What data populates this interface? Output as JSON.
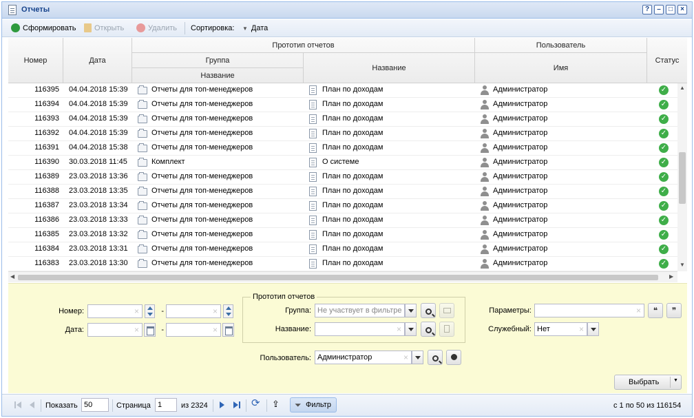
{
  "window": {
    "title": "Отчеты",
    "buttons": [
      "?",
      "–",
      "□",
      "×"
    ]
  },
  "toolbar": {
    "generate": "Сформировать",
    "open": "Открыть",
    "delete": "Удалить",
    "sort_label": "Сортировка:",
    "sort_value": "Дата"
  },
  "grid": {
    "headers": {
      "number": "Номер",
      "date": "Дата",
      "prototype": "Прототип отчетов",
      "group": "Группа",
      "group_name": "Название",
      "name": "Название",
      "user": "Пользователь",
      "user_name": "Имя",
      "status": "Статус"
    },
    "rows": [
      {
        "num": "116395",
        "date": "04.04.2018 15:39",
        "group": "Отчеты для топ-менеджеров",
        "name": "План по доходам",
        "user": "Администратор"
      },
      {
        "num": "116394",
        "date": "04.04.2018 15:39",
        "group": "Отчеты для топ-менеджеров",
        "name": "План по доходам",
        "user": "Администратор"
      },
      {
        "num": "116393",
        "date": "04.04.2018 15:39",
        "group": "Отчеты для топ-менеджеров",
        "name": "План по доходам",
        "user": "Администратор"
      },
      {
        "num": "116392",
        "date": "04.04.2018 15:39",
        "group": "Отчеты для топ-менеджеров",
        "name": "План по доходам",
        "user": "Администратор"
      },
      {
        "num": "116391",
        "date": "04.04.2018 15:38",
        "group": "Отчеты для топ-менеджеров",
        "name": "План по доходам",
        "user": "Администратор"
      },
      {
        "num": "116390",
        "date": "30.03.2018 11:45",
        "group": "Комплект",
        "name": "О системе",
        "user": "Администратор"
      },
      {
        "num": "116389",
        "date": "23.03.2018 13:36",
        "group": "Отчеты для топ-менеджеров",
        "name": "План по доходам",
        "user": "Администратор"
      },
      {
        "num": "116388",
        "date": "23.03.2018 13:35",
        "group": "Отчеты для топ-менеджеров",
        "name": "План по доходам",
        "user": "Администратор"
      },
      {
        "num": "116387",
        "date": "23.03.2018 13:34",
        "group": "Отчеты для топ-менеджеров",
        "name": "План по доходам",
        "user": "Администратор"
      },
      {
        "num": "116386",
        "date": "23.03.2018 13:33",
        "group": "Отчеты для топ-менеджеров",
        "name": "План по доходам",
        "user": "Администратор"
      },
      {
        "num": "116385",
        "date": "23.03.2018 13:32",
        "group": "Отчеты для топ-менеджеров",
        "name": "План по доходам",
        "user": "Администратор"
      },
      {
        "num": "116384",
        "date": "23.03.2018 13:31",
        "group": "Отчеты для топ-менеджеров",
        "name": "План по доходам",
        "user": "Администратор"
      },
      {
        "num": "116383",
        "date": "23.03.2018 13:30",
        "group": "Отчеты для топ-менеджеров",
        "name": "План по доходам",
        "user": "Администратор"
      }
    ]
  },
  "filter": {
    "number_label": "Номер:",
    "date_label": "Дата:",
    "range_sep": "-",
    "prototype_legend": "Прототип отчетов",
    "group_label": "Группа:",
    "group_value": "Не участвует в фильтре",
    "name_label": "Название:",
    "user_label": "Пользователь:",
    "user_value": "Администратор",
    "params_label": "Параметры:",
    "service_label": "Служебный:",
    "service_value": "Нет",
    "quote_open": "❝",
    "quote_close": "❞",
    "select_button": "Выбрать"
  },
  "pager": {
    "show_label": "Показать",
    "page_size": "50",
    "page_label": "Страница",
    "page": "1",
    "of_pages": "из 2324",
    "filter_button": "Фильтр",
    "summary": "с 1 по 50 из 116154"
  }
}
